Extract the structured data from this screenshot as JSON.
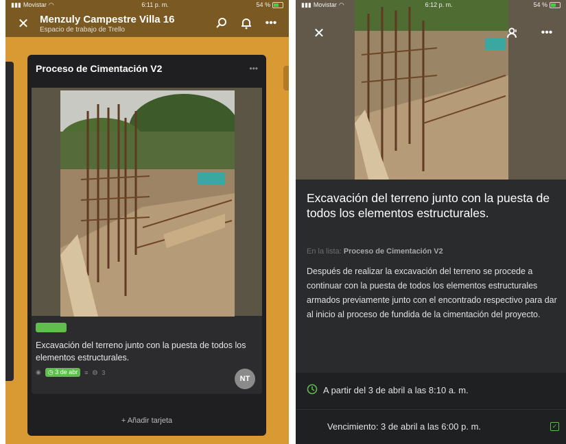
{
  "left": {
    "status": {
      "carrier": "Movistar",
      "time": "6:11 p. m.",
      "battery": "54 %"
    },
    "board_title": "Menzuly Campestre Villa 16",
    "workspace": "Espacio de trabajo de Trello",
    "list_title": "Proceso de Cimentación V2",
    "card_title": "Excavación del terreno junto con la puesta de todos los elementos estructurales.",
    "due_badge": "3 de abr",
    "comments": "3",
    "member": "NT",
    "add_card": "+ Añadir tarjeta"
  },
  "right": {
    "status": {
      "carrier": "Movistar",
      "time": "6:12 p. m.",
      "battery": "54 %"
    },
    "card_title": "Excavación del terreno junto con la puesta de todos los elementos estructurales.",
    "in_list_label": "En la lista:",
    "in_list_value": "Proceso de Cimentación V2",
    "description": "Después de realizar la excavación del terreno se procede a continuar con la puesta de todos los elementos estructurales armados previamente junto con el encontrado respectivo para dar al inicio al proceso de fundida de la cimentación del proyecto.",
    "start": "A partir del 3 de abril a las 8:10 a. m.",
    "due": "Vencimiento: 3 de abril a las 6:00 p. m."
  },
  "colors": {
    "board_bg": "#d99a33",
    "label_green": "#61bd4f",
    "list_bg": "#1f1f21"
  }
}
